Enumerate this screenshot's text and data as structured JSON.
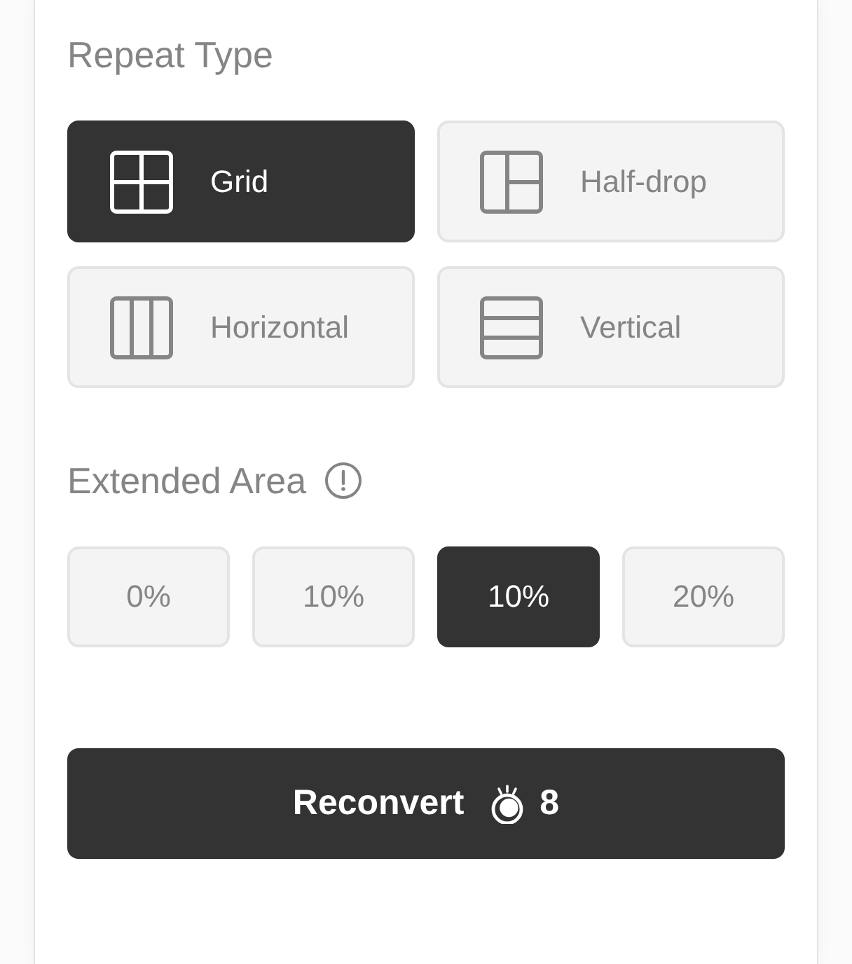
{
  "repeat_type": {
    "heading": "Repeat Type",
    "options": [
      {
        "kind": "grid",
        "label": "Grid",
        "selected": true
      },
      {
        "kind": "half-drop",
        "label": "Half-drop",
        "selected": false
      },
      {
        "kind": "horizontal",
        "label": "Horizontal",
        "selected": false
      },
      {
        "kind": "vertical",
        "label": "Vertical",
        "selected": false
      }
    ]
  },
  "extended_area": {
    "heading": "Extended Area",
    "options": [
      {
        "label": "0%",
        "selected": false
      },
      {
        "label": "10%",
        "selected": false
      },
      {
        "label": "10%",
        "selected": true
      },
      {
        "label": "20%",
        "selected": false
      }
    ]
  },
  "reconvert_button": {
    "label": "Reconvert",
    "cost": "8"
  }
}
